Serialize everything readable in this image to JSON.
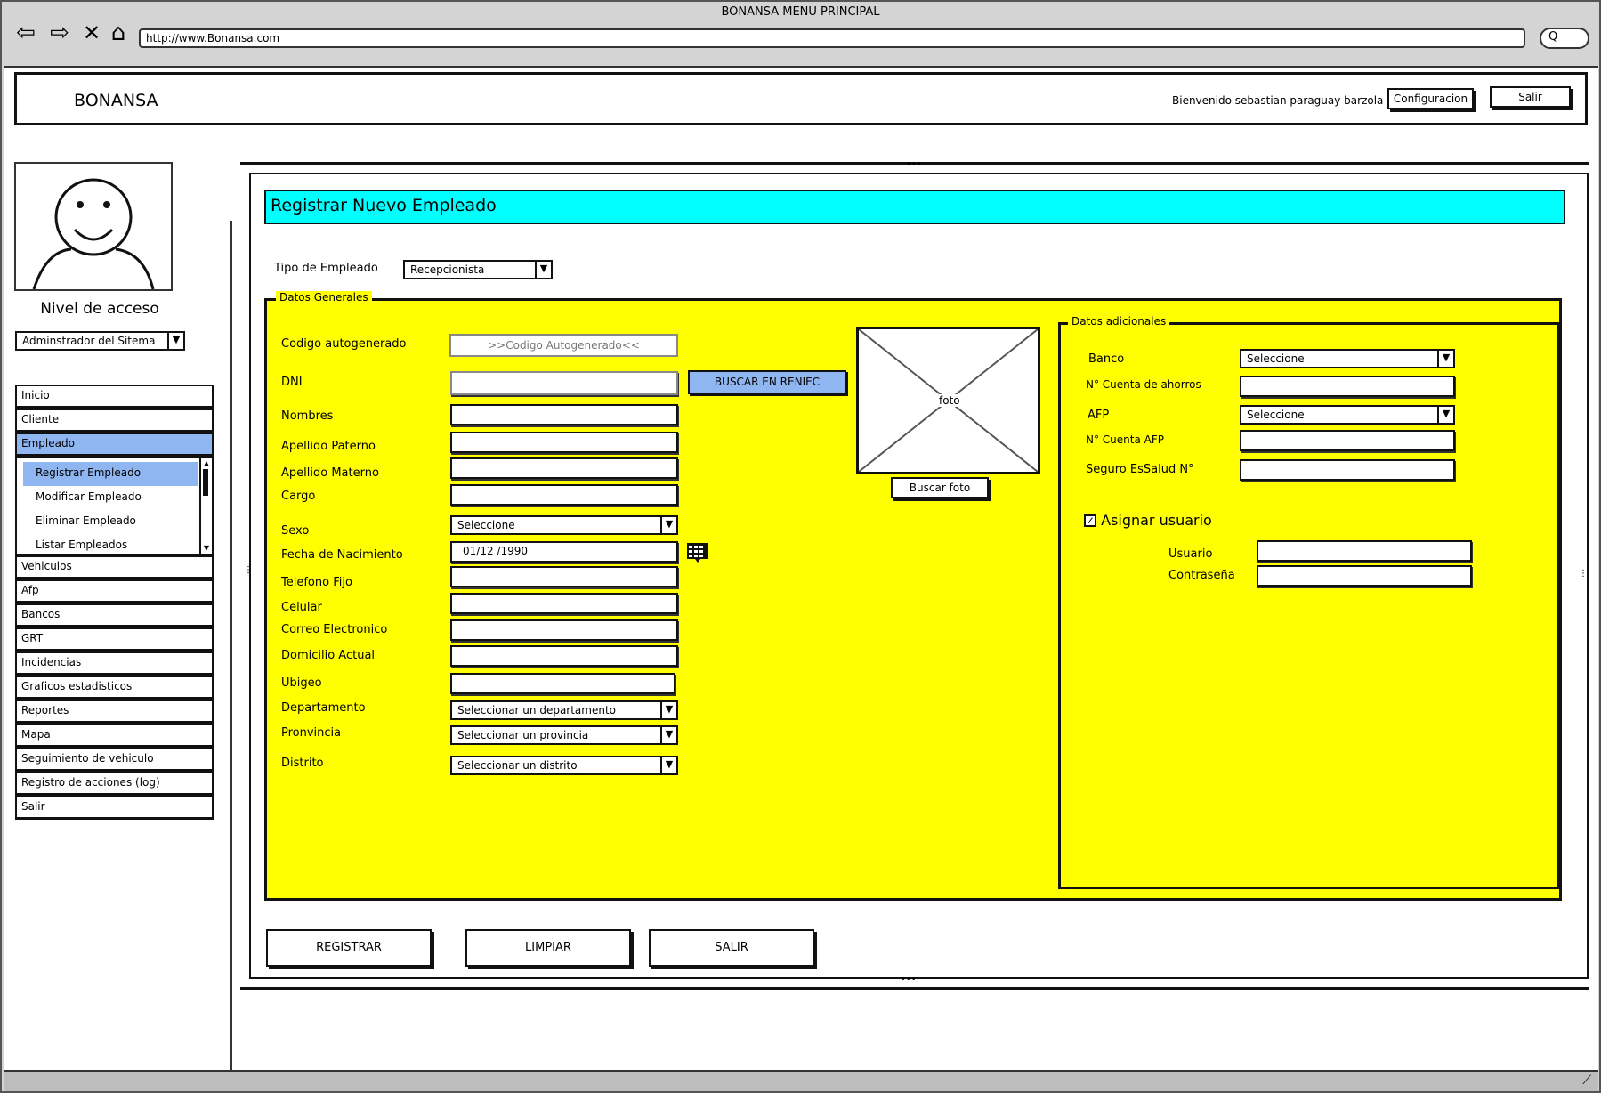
{
  "browser": {
    "title": "BONANSA MENU PRINCIPAL",
    "url": "http://www.Bonansa.com",
    "search_icon": "Q"
  },
  "header": {
    "brand": "BONANSA",
    "welcome": "Bienvenido sebastian paraguay barzola",
    "config_label": "Configuracion",
    "logout_label": "Salir"
  },
  "sidebar": {
    "access_label": "Nivel de acceso",
    "access_value": "Adminstrador del Sitema",
    "menu": [
      {
        "label": "Inicio"
      },
      {
        "label": "Cliente"
      },
      {
        "label": "Empleado"
      },
      {
        "label": "Vehiculos"
      },
      {
        "label": "Afp"
      },
      {
        "label": "Bancos"
      },
      {
        "label": "GRT"
      },
      {
        "label": "Incidencias"
      },
      {
        "label": "Graficos estadisticos"
      },
      {
        "label": "Reportes"
      },
      {
        "label": "Mapa"
      },
      {
        "label": "Seguimiento de vehiculo"
      },
      {
        "label": "Registro de acciones (log)"
      },
      {
        "label": "Salir"
      }
    ],
    "submenu": [
      {
        "label": "Registrar Empleado"
      },
      {
        "label": "Modificar Empleado"
      },
      {
        "label": "Eliminar Empleado"
      },
      {
        "label": "Listar Empleados"
      }
    ]
  },
  "form": {
    "title": "Registrar Nuevo Empleado",
    "tipo_label": "Tipo de Empleado",
    "tipo_value": "Recepcionista",
    "generales_legend": "Datos Generales",
    "fields": {
      "codigo": {
        "label": "Codigo autogenerado",
        "value": ">>Codigo Autogenerado<<"
      },
      "dni": {
        "label": "DNI",
        "value": ""
      },
      "nombres": {
        "label": "Nombres",
        "value": ""
      },
      "ap_paterno": {
        "label": "Apellido Paterno",
        "value": ""
      },
      "ap_materno": {
        "label": "Apellido Materno",
        "value": ""
      },
      "cargo": {
        "label": "Cargo",
        "value": ""
      },
      "sexo": {
        "label": "Sexo",
        "value": "Seleccione"
      },
      "fecha_nac": {
        "label": "Fecha de Nacimiento",
        "value": "01/12  /1990"
      },
      "tel_fijo": {
        "label": "Telefono Fijo",
        "value": ""
      },
      "celular": {
        "label": "Celular",
        "value": ""
      },
      "correo": {
        "label": "Correo Electronico",
        "value": ""
      },
      "domicilio": {
        "label": "Domicilio Actual",
        "value": ""
      },
      "ubigeo": {
        "label": "Ubigeo",
        "value": ""
      },
      "departamento": {
        "label": "Departamento",
        "value": "Seleccionar un departamento"
      },
      "provincia": {
        "label": "Pronvincia",
        "value": "Seleccionar un provincia"
      },
      "distrito": {
        "label": "Distrito",
        "value": "Seleccionar un distrito"
      }
    },
    "reniec_label": "BUSCAR EN RENIEC",
    "photo_label": "foto",
    "buscar_foto_label": "Buscar foto",
    "adicionales_legend": "Datos adicionales",
    "adicionales": {
      "banco": {
        "label": "Banco",
        "value": "Seleccione"
      },
      "cuenta_ahorros": {
        "label": "N° Cuenta de ahorros",
        "value": ""
      },
      "afp": {
        "label": "AFP",
        "value": "Seleccione"
      },
      "cuenta_afp": {
        "label": "N° Cuenta AFP",
        "value": ""
      },
      "essalud": {
        "label": "Seguro EsSalud N°",
        "value": ""
      }
    },
    "asignar_label": "Asignar usuario",
    "asignar_checked": true,
    "usuario_label": "Usuario",
    "contrasena_label": "Contraseña",
    "buttons": {
      "registrar": "REGISTRAR",
      "limpiar": "LIMPIAR",
      "salir": "SALIR"
    }
  },
  "colors": {
    "banner": "#00ffff",
    "panel": "#ffff00",
    "highlight": "#8fb6f0"
  }
}
